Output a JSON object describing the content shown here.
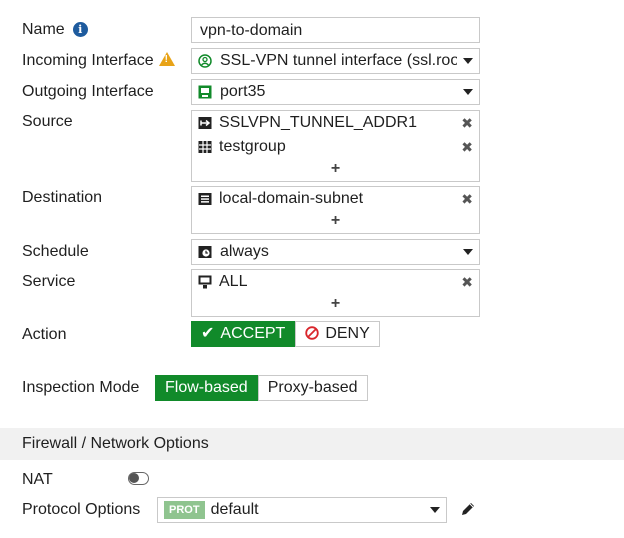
{
  "form": {
    "name": {
      "label": "Name",
      "value": "vpn-to-domain"
    },
    "incoming_interface": {
      "label": "Incoming Interface",
      "value": "SSL-VPN tunnel interface (ssl.roo"
    },
    "outgoing_interface": {
      "label": "Outgoing Interface",
      "value": "port35"
    },
    "source": {
      "label": "Source",
      "items": [
        "SSLVPN_TUNNEL_ADDR1",
        "testgroup"
      ],
      "add": "+"
    },
    "destination": {
      "label": "Destination",
      "items": [
        "local-domain-subnet"
      ],
      "add": "+"
    },
    "schedule": {
      "label": "Schedule",
      "value": "always"
    },
    "service": {
      "label": "Service",
      "items": [
        "ALL"
      ],
      "add": "+"
    },
    "action": {
      "label": "Action",
      "options": [
        "ACCEPT",
        "DENY"
      ],
      "selected": "ACCEPT"
    },
    "inspection_mode": {
      "label": "Inspection Mode",
      "options": [
        "Flow-based",
        "Proxy-based"
      ],
      "selected": "Flow-based"
    }
  },
  "section": {
    "title": "Firewall / Network Options"
  },
  "nat": {
    "label": "NAT",
    "enabled": false
  },
  "protocol_options": {
    "label": "Protocol Options",
    "badge": "PROT",
    "value": "default"
  },
  "colors": {
    "accent_green": "#118a2a",
    "info_blue": "#1e5b9e",
    "warning": "#e8a317",
    "deny_red": "#d9262c"
  }
}
